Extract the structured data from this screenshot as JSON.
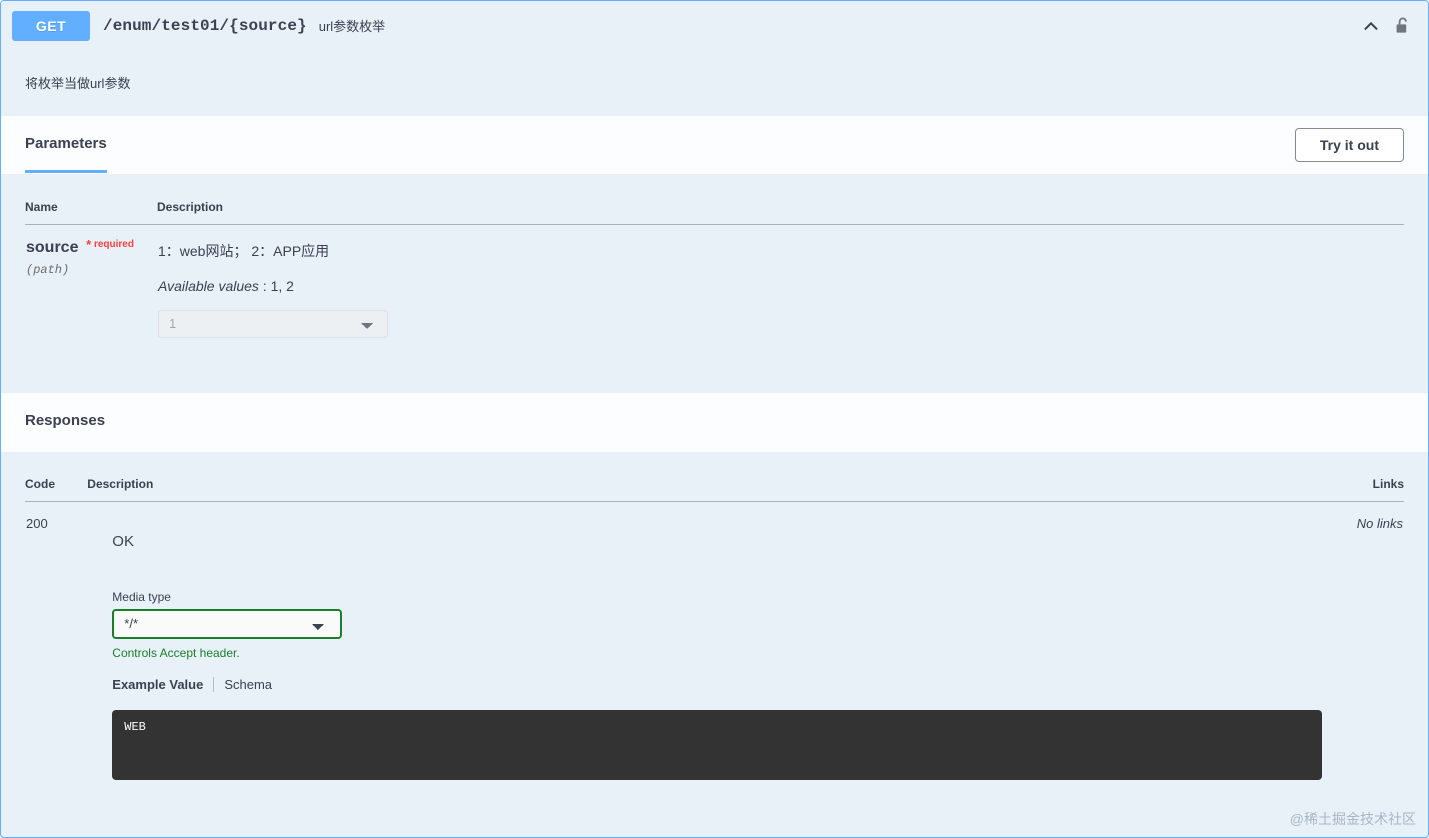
{
  "operation": {
    "method": "GET",
    "path": "/enum/test01/{source}",
    "summary": "url参数枚举",
    "description": "将枚举当做url参数",
    "collapse_icon": "chevron-up-icon",
    "auth_icon": "unlocked-padlock-icon",
    "accent_color": "#61affe"
  },
  "parameters": {
    "tab_label": "Parameters",
    "try_it_out_label": "Try it out",
    "columns": {
      "name": "Name",
      "description": "Description"
    },
    "rows": [
      {
        "name": "source",
        "required_label": "required",
        "required_star": "*",
        "in": "(path)",
        "description": "1：web网站；  2：APP应用",
        "available_values_label": "Available values",
        "available_values": "1, 2",
        "select_value": "1",
        "select_options": [
          "1",
          "2"
        ]
      }
    ]
  },
  "responses": {
    "tab_label": "Responses",
    "columns": {
      "code": "Code",
      "description": "Description",
      "links": "Links"
    },
    "rows": [
      {
        "code": "200",
        "description": "OK",
        "links": "No links",
        "media_type_label": "Media type",
        "media_type_value": "*/*",
        "media_type_options": [
          "*/*"
        ],
        "accept_hint": "Controls Accept header.",
        "example_value_tab": "Example Value",
        "schema_tab": "Schema",
        "example_body": "WEB"
      }
    ]
  },
  "watermark": "@稀土掘金技术社区"
}
